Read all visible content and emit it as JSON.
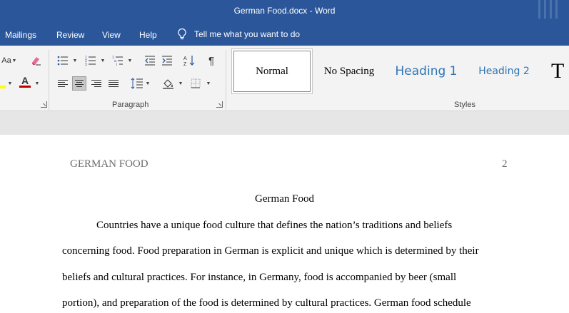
{
  "titlebar": {
    "title": "German Food.docx  -  Word"
  },
  "menu": {
    "tabs": [
      "Mailings",
      "Review",
      "View",
      "Help"
    ],
    "tell_me": "Tell me what you want to do"
  },
  "ribbon": {
    "font_group": {
      "aa_label": "Aa",
      "font_color_label": "A"
    },
    "paragraph_group": {
      "label": "Paragraph"
    },
    "styles_group": {
      "label": "Styles",
      "items": [
        "Normal",
        "No Spacing",
        "Heading 1",
        "Heading 2",
        "T"
      ]
    }
  },
  "document": {
    "header_left": "GERMAN FOOD",
    "header_right": "2",
    "title": "German Food",
    "lines": [
      "Countries have a unique food culture that defines the nation’s traditions and beliefs",
      "concerning food. Food preparation in German is explicit and unique which is determined by their",
      "beliefs and cultural practices. For instance, in Germany, food is accompanied by beer (small",
      "portion), and preparation of the food is determined by cultural practices. German food schedule"
    ]
  },
  "colors": {
    "accent": "#2b579a",
    "heading": "#2e74b5",
    "font_color_bar": "#c00000",
    "highlight": "#ffff00"
  }
}
